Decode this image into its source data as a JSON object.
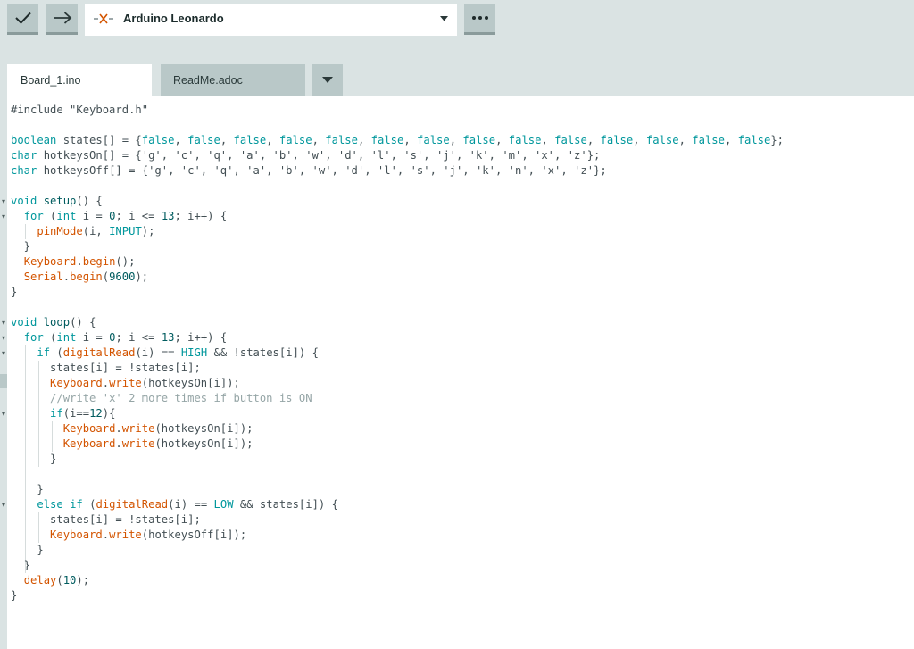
{
  "toolbar": {
    "verify_icon": "checkmark-icon",
    "upload_icon": "arrow-right-icon",
    "more_icon": "ellipsis-icon",
    "board": {
      "status_icon": "disconnected-x-icon",
      "name": "Arduino Leonardo",
      "dropdown_icon": "triangle-down-icon"
    }
  },
  "tabs": [
    {
      "label": "Board_1.ino",
      "active": true
    },
    {
      "label": "ReadMe.adoc",
      "active": false
    }
  ],
  "tab_menu_icon": "triangle-down-icon",
  "colors": {
    "keyword": "#00979c",
    "function": "#d35400",
    "comment": "#95a5a6",
    "text": "#434f54",
    "toolbar_bg": "#dae3e3",
    "button_bg": "#b9c8c8"
  },
  "code": {
    "lines": [
      [
        [
          "#include \"Keyboard.h\"",
          ""
        ]
      ],
      [],
      [
        [
          "boolean",
          "k"
        ],
        [
          " states[] = {",
          ""
        ],
        [
          "false",
          "k"
        ],
        [
          ", ",
          ""
        ],
        [
          "false",
          "k"
        ],
        [
          ", ",
          ""
        ],
        [
          "false",
          "k"
        ],
        [
          ", ",
          ""
        ],
        [
          "false",
          "k"
        ],
        [
          ", ",
          ""
        ],
        [
          "false",
          "k"
        ],
        [
          ", ",
          ""
        ],
        [
          "false",
          "k"
        ],
        [
          ", ",
          ""
        ],
        [
          "false",
          "k"
        ],
        [
          ", ",
          ""
        ],
        [
          "false",
          "k"
        ],
        [
          ", ",
          ""
        ],
        [
          "false",
          "k"
        ],
        [
          ", ",
          ""
        ],
        [
          "false",
          "k"
        ],
        [
          ", ",
          ""
        ],
        [
          "false",
          "k"
        ],
        [
          ", ",
          ""
        ],
        [
          "false",
          "k"
        ],
        [
          ", ",
          ""
        ],
        [
          "false",
          "k"
        ],
        [
          ", ",
          ""
        ],
        [
          "false",
          "k"
        ],
        [
          "};",
          ""
        ]
      ],
      [
        [
          "char",
          "k"
        ],
        [
          " hotkeysOn[] = {'g', 'c', 'q', 'a', 'b', 'w', 'd', 'l', 's', 'j', 'k', 'm', 'x', 'z'};",
          ""
        ]
      ],
      [
        [
          "char",
          "k"
        ],
        [
          " hotkeysOff[] = {'g', 'c', 'q', 'a', 'b', 'w', 'd', 'l', 's', 'j', 'k', 'n', 'x', 'z'};",
          ""
        ]
      ],
      [],
      [
        [
          "void",
          "k"
        ],
        [
          " ",
          ""
        ],
        [
          "setup",
          "n"
        ],
        [
          "() {",
          ""
        ]
      ],
      [
        [
          "  ",
          ""
        ],
        [
          "for",
          "k"
        ],
        [
          " (",
          ""
        ],
        [
          "int",
          "k"
        ],
        [
          " i = ",
          ""
        ],
        [
          "0",
          "n"
        ],
        [
          "; i <= ",
          ""
        ],
        [
          "13",
          "n"
        ],
        [
          "; i++) {",
          ""
        ]
      ],
      [
        [
          "    ",
          ""
        ],
        [
          "pinMode",
          "f"
        ],
        [
          "(i, ",
          ""
        ],
        [
          "INPUT",
          "k"
        ],
        [
          ");",
          ""
        ]
      ],
      [
        [
          "  }",
          ""
        ]
      ],
      [
        [
          "  ",
          ""
        ],
        [
          "Keyboard",
          "f"
        ],
        [
          ".",
          ""
        ],
        [
          "begin",
          "f"
        ],
        [
          "();",
          ""
        ]
      ],
      [
        [
          "  ",
          ""
        ],
        [
          "Serial",
          "f"
        ],
        [
          ".",
          ""
        ],
        [
          "begin",
          "f"
        ],
        [
          "(",
          ""
        ],
        [
          "9600",
          "n"
        ],
        [
          ");",
          ""
        ]
      ],
      [
        [
          "}",
          ""
        ]
      ],
      [],
      [
        [
          "void",
          "k"
        ],
        [
          " ",
          ""
        ],
        [
          "loop",
          "n"
        ],
        [
          "() {",
          ""
        ]
      ],
      [
        [
          "  ",
          ""
        ],
        [
          "for",
          "k"
        ],
        [
          " (",
          ""
        ],
        [
          "int",
          "k"
        ],
        [
          " i = ",
          ""
        ],
        [
          "0",
          "n"
        ],
        [
          "; i <= ",
          ""
        ],
        [
          "13",
          "n"
        ],
        [
          "; i++) {",
          ""
        ]
      ],
      [
        [
          "    ",
          ""
        ],
        [
          "if",
          "k"
        ],
        [
          " (",
          ""
        ],
        [
          "digitalRead",
          "f"
        ],
        [
          "(i) == ",
          ""
        ],
        [
          "HIGH",
          "k"
        ],
        [
          " && !states[i]) {",
          ""
        ]
      ],
      [
        [
          "      states[i] = !states[i];",
          ""
        ]
      ],
      [
        [
          "      ",
          ""
        ],
        [
          "Keyboard",
          "f"
        ],
        [
          ".",
          ""
        ],
        [
          "write",
          "f"
        ],
        [
          "(hotkeysOn[i]);",
          ""
        ]
      ],
      [
        [
          "      ",
          ""
        ],
        [
          "//write 'x' 2 more times if button is ON",
          "c"
        ]
      ],
      [
        [
          "      ",
          ""
        ],
        [
          "if",
          "k"
        ],
        [
          "(i==",
          ""
        ],
        [
          "12",
          "n"
        ],
        [
          "){",
          ""
        ]
      ],
      [
        [
          "        ",
          ""
        ],
        [
          "Keyboard",
          "f"
        ],
        [
          ".",
          ""
        ],
        [
          "write",
          "f"
        ],
        [
          "(hotkeysOn[i]);",
          ""
        ]
      ],
      [
        [
          "        ",
          ""
        ],
        [
          "Keyboard",
          "f"
        ],
        [
          ".",
          ""
        ],
        [
          "write",
          "f"
        ],
        [
          "(hotkeysOn[i]);",
          ""
        ]
      ],
      [
        [
          "      }",
          ""
        ]
      ],
      [],
      [
        [
          "    }",
          ""
        ]
      ],
      [
        [
          "    ",
          ""
        ],
        [
          "else",
          "k"
        ],
        [
          " ",
          ""
        ],
        [
          "if",
          "k"
        ],
        [
          " (",
          ""
        ],
        [
          "digitalRead",
          "f"
        ],
        [
          "(i) == ",
          ""
        ],
        [
          "LOW",
          "k"
        ],
        [
          " && states[i]) {",
          ""
        ]
      ],
      [
        [
          "      states[i] = !states[i];",
          ""
        ]
      ],
      [
        [
          "      ",
          ""
        ],
        [
          "Keyboard",
          "f"
        ],
        [
          ".",
          ""
        ],
        [
          "write",
          "f"
        ],
        [
          "(hotkeysOff[i]);",
          ""
        ]
      ],
      [
        [
          "    }",
          ""
        ]
      ],
      [
        [
          "  }",
          ""
        ]
      ],
      [
        [
          "  ",
          ""
        ],
        [
          "delay",
          "f"
        ],
        [
          "(",
          ""
        ],
        [
          "10",
          "n"
        ],
        [
          ");",
          ""
        ]
      ],
      [
        [
          "}",
          ""
        ]
      ]
    ]
  }
}
